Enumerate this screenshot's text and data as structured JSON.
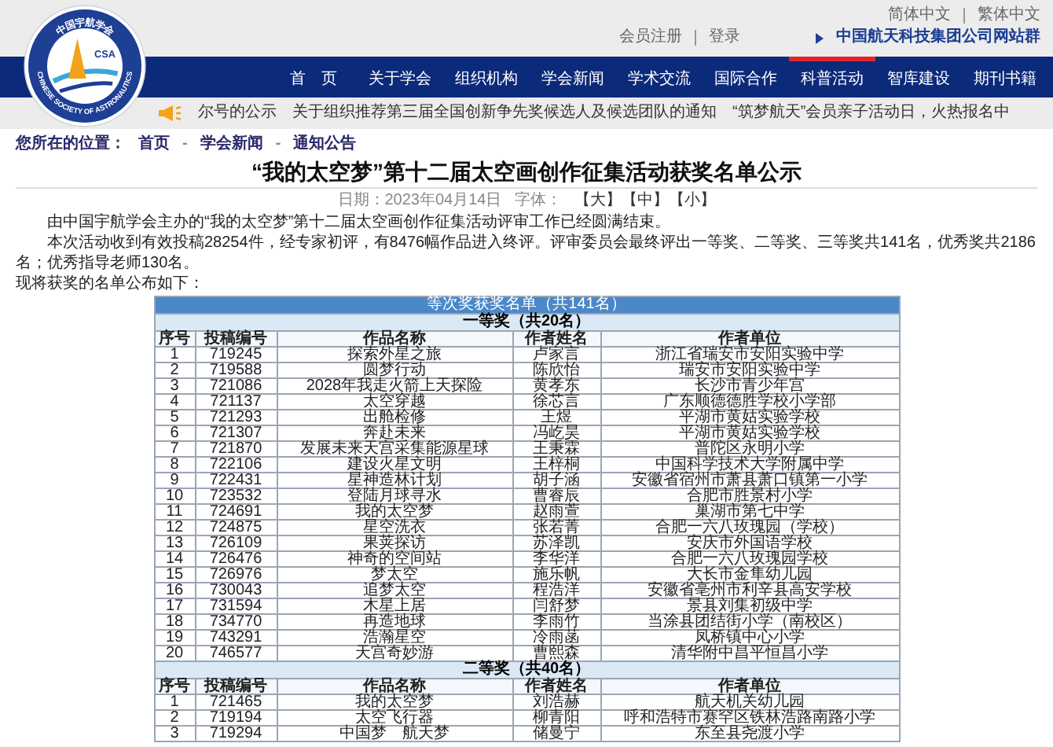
{
  "logo": {
    "top_text": "中国宇航学会",
    "mark": "CSA",
    "bottom_text": "CHINESE SOCIETY OF ASTRONAUTICS"
  },
  "top_links": {
    "languages": [
      "简体中文",
      "繁体中文"
    ],
    "account": [
      "会员注册",
      "登录"
    ],
    "group_link": "中国航天科技集团公司网站群"
  },
  "nav": [
    {
      "label": "首　页",
      "selected": false
    },
    {
      "label": "关于学会",
      "selected": false
    },
    {
      "label": "组织机构",
      "selected": false
    },
    {
      "label": "学会新闻",
      "selected": false
    },
    {
      "label": "学术交流",
      "selected": false
    },
    {
      "label": "国际合作",
      "selected": false
    },
    {
      "label": "科普活动",
      "selected": true
    },
    {
      "label": "智库建设",
      "selected": false
    },
    {
      "label": "期刊书籍",
      "selected": false
    }
  ],
  "notices": [
    "尔号的公示",
    "关于组织推荐第三届全国创新争先奖候选人及候选团队的通知",
    "“筑梦航天”会员亲子活动日，火热报名中"
  ],
  "breadcrumb": {
    "label": "您所在的位置：",
    "parts": [
      {
        "kind": "link",
        "text": "首页"
      },
      {
        "kind": "separator",
        "text": "-"
      },
      {
        "kind": "link",
        "text": "学会新闻"
      },
      {
        "kind": "separator",
        "text": "-"
      },
      {
        "kind": "link",
        "text": "通知公告"
      }
    ]
  },
  "article": {
    "title": "“我的太空梦”第十二届太空画创作征集活动获奖名单公示",
    "date": "日期：2023年04月14日",
    "font_label": "字体：",
    "font_sizes": [
      "【大】",
      "【中】",
      "【小】"
    ],
    "paragraphs": [
      "由中国宇航学会主办的“我的太空梦”第十二届太空画创作征集活动评审工作已经圆满结束。",
      "本次活动收到有效投稿28254件，经专家初评，有8476幅作品进入终评。评审委员会最终评出一等奖、二等奖、三等奖共141名，优秀奖共2186名；优秀指导老师130名。",
      "现将获奖的名单公布如下："
    ]
  },
  "table": {
    "title": "等次奖获奖名单（共141名）",
    "sections": [
      {
        "title": "一等奖（共20名）",
        "columns": [
          "序号",
          "投稿编号",
          "作品名称",
          "作者姓名",
          "作者单位"
        ],
        "rows": [
          [
            "1",
            "719245",
            "探索外星之旅",
            "卢家言",
            "浙江省瑞安市安阳实验中学"
          ],
          [
            "2",
            "719588",
            "圆梦行动",
            "陈欣怡",
            "瑞安市安阳实验中学"
          ],
          [
            "3",
            "721086",
            "2028年我走火箭上天探险",
            "黄孝东",
            "长沙市青少年宫"
          ],
          [
            "4",
            "721137",
            "太空穿越",
            "徐芯言",
            "广东顺德德胜学校小学部"
          ],
          [
            "5",
            "721293",
            "出舱检修",
            "王煜",
            "平湖市黄姑实验学校"
          ],
          [
            "6",
            "721307",
            "奔赴未来",
            "冯屹昊",
            "平湖市黄姑实验学校"
          ],
          [
            "7",
            "721870",
            "发展未来天宫采集能源星球",
            "王秉霖",
            "普陀区永明小学"
          ],
          [
            "8",
            "722106",
            "建设火星文明",
            "王梓桐",
            "中国科学技术大学附属中学"
          ],
          [
            "9",
            "722431",
            "星神造林计划",
            "胡子涵",
            "安徽省宿州市萧县萧口镇第一小学"
          ],
          [
            "10",
            "723532",
            "登陆月球寻水",
            "曹睿辰",
            "合肥市胜景村小学"
          ],
          [
            "11",
            "724691",
            "我的太空梦",
            "赵雨萱",
            "巢湖市第七中学"
          ],
          [
            "12",
            "724875",
            "星空洗衣",
            "张若菁",
            "合肥一六八玫瑰园（学校）"
          ],
          [
            "13",
            "726109",
            "果荚探访",
            "苏泽凯",
            "安庆市外国语学校"
          ],
          [
            "14",
            "726476",
            "神奇的空间站",
            "李华洋",
            "合肥一六八玫瑰园学校"
          ],
          [
            "15",
            "726976",
            "梦太空",
            "施乐帆",
            "大长市金隼幼儿园"
          ],
          [
            "16",
            "730043",
            "追梦太空",
            "程浩洋",
            "安徽省亳州市利辛县高安学校"
          ],
          [
            "17",
            "731594",
            "木星上居",
            "闫舒梦",
            "景县刘集初级中学"
          ],
          [
            "18",
            "734770",
            "再造地球",
            "李雨竹",
            "当涂县团结街小学（南校区）"
          ],
          [
            "19",
            "743291",
            "浩瀚星空",
            "冷雨菡",
            "凤桥镇中心小学"
          ],
          [
            "20",
            "746577",
            "天宫奇妙游",
            "曹熙森",
            "清华附中昌平恒昌小学"
          ]
        ]
      },
      {
        "title": "二等奖（共40名）",
        "columns": [
          "序号",
          "投稿编号",
          "作品名称",
          "作者姓名",
          "作者单位"
        ],
        "rows": [
          [
            "1",
            "721465",
            "我的太空梦",
            "刘浩赫",
            "航天机关幼儿园"
          ],
          [
            "2",
            "719194",
            "太空飞行器",
            "柳青阳",
            "呼和浩特市赛罕区铁林浩路南路小学"
          ],
          [
            "3",
            "719294",
            "中国梦　航天梦",
            "储曼宁",
            "东至县尧渡小学"
          ]
        ]
      }
    ]
  }
}
